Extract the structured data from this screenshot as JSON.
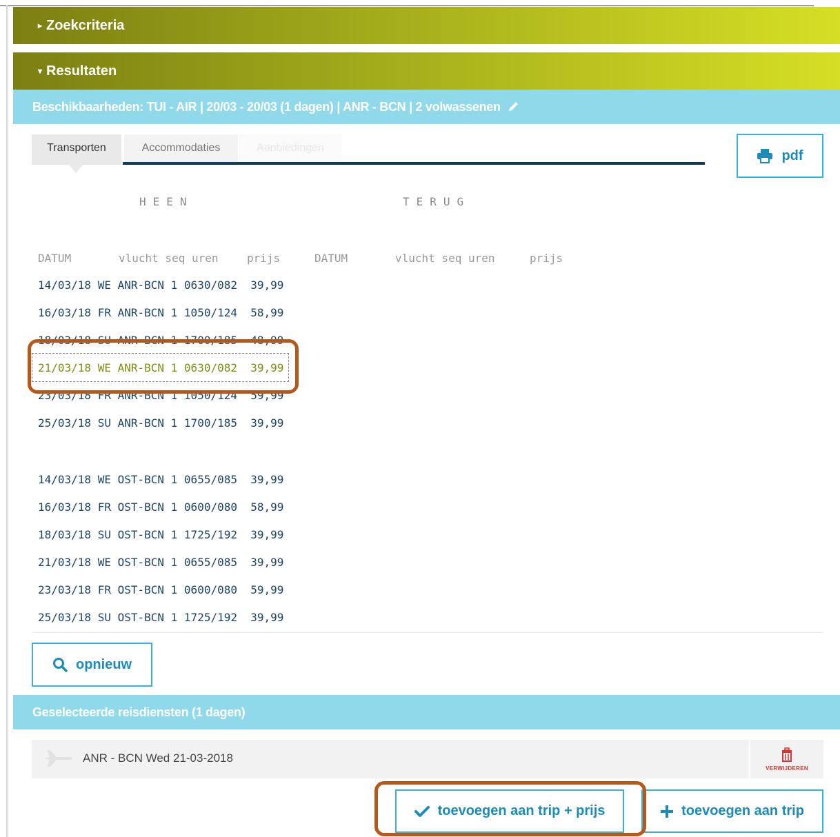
{
  "sections": {
    "search_criteria": "Zoekcriteria",
    "results": "Resultaten"
  },
  "availability_header": "Beschikbaarheden: TUI - AIR | 20/03 - 20/03 (1 dagen) | ANR - BCN | 2 volwassenen",
  "tabs": [
    {
      "label": "Transporten",
      "state": "active"
    },
    {
      "label": "Accommodaties",
      "state": "inactive"
    },
    {
      "label": "Aanbiedingen",
      "state": "disabled"
    }
  ],
  "pdf_label": "pdf",
  "headings": {
    "outbound": "HEEN",
    "return": "TERUG"
  },
  "columns": {
    "outbound": {
      "date": "DATUM",
      "flight": "vlucht seq uren",
      "price": "prijs"
    },
    "return": {
      "date": "DATUM",
      "flight": "vlucht seq uren",
      "price": "prijs"
    }
  },
  "flights_anr": [
    {
      "text": "14/03/18 WE ANR-BCN 1 0630/082  39,99"
    },
    {
      "text": "16/03/18 FR ANR-BCN 1 1050/124  58,99"
    },
    {
      "text": "18/03/18 SU ANR-BCN 1 1700/185  48,99"
    },
    {
      "text": "21/03/18 WE ANR-BCN 1 0630/082  39,99",
      "selected": true
    },
    {
      "text": "23/03/18 FR ANR-BCN 1 1050/124  59,99"
    },
    {
      "text": "25/03/18 SU ANR-BCN 1 1700/185  39,99"
    }
  ],
  "flights_ost": [
    {
      "text": "14/03/18 WE OST-BCN 1 0655/085  39,99"
    },
    {
      "text": "16/03/18 FR OST-BCN 1 0600/080  58,99"
    },
    {
      "text": "18/03/18 SU OST-BCN 1 1725/192  39,99"
    },
    {
      "text": "21/03/18 WE OST-BCN 1 0655/085  39,99"
    },
    {
      "text": "23/03/18 FR OST-BCN 1 0600/080  59,99"
    },
    {
      "text": "25/03/18 SU OST-BCN 1 1725/192  39,99"
    }
  ],
  "search_again_label": "opnieuw",
  "selected_header": "Geselecteerde reisdiensten (1 dagen)",
  "selected_service": {
    "text": "ANR - BCN Wed 21-03-2018",
    "icon": "plane-icon"
  },
  "delete_label": "VERWIJDEREN",
  "add_with_price_label": "toevoegen aan trip + prijs",
  "add_label": "toevoegen aan trip",
  "colors": {
    "accent": "#1b8bb8",
    "header_bar_start": "#7c7f12",
    "header_bar_end": "#d6df24",
    "info_bar": "#8fd9eb",
    "annotation": "#b5581c",
    "delete": "#d33333"
  }
}
